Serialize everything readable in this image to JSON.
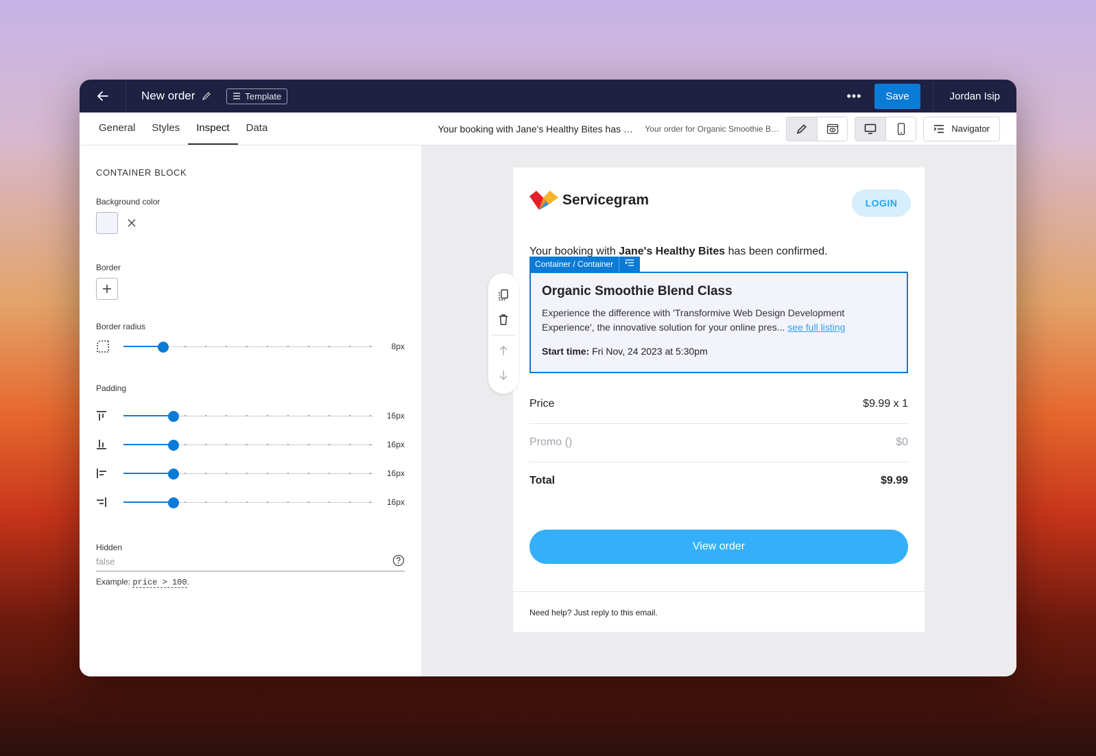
{
  "topbar": {
    "title": "New order",
    "template_label": "Template",
    "more_label": "•••",
    "save_label": "Save",
    "user_name": "Jordan Isip"
  },
  "tabs": [
    {
      "label": "General"
    },
    {
      "label": "Styles"
    },
    {
      "label": "Inspect",
      "active": true
    },
    {
      "label": "Data"
    }
  ],
  "subject": {
    "main": "Your booking with Jane's Healthy Bites has been confirmed",
    "preview": "Your order for Organic Smoothie Blend Class"
  },
  "navigator_label": "Navigator",
  "inspector": {
    "section_title": "CONTAINER BLOCK",
    "background_color": {
      "label": "Background color",
      "value": "#f2f3fb"
    },
    "border": {
      "label": "Border"
    },
    "border_radius": {
      "label": "Border radius",
      "value": "8px",
      "fraction": 0.16
    },
    "padding": {
      "label": "Padding",
      "top": {
        "value": "16px",
        "fraction": 0.2
      },
      "bottom": {
        "value": "16px",
        "fraction": 0.2
      },
      "left": {
        "value": "16px",
        "fraction": 0.2
      },
      "right": {
        "value": "16px",
        "fraction": 0.2
      }
    },
    "hidden": {
      "label": "Hidden",
      "placeholder": "false",
      "example_prefix": "Example: ",
      "example_code": "price > 100",
      "example_suffix": "."
    }
  },
  "email": {
    "brand": "Servicegram",
    "login_label": "LOGIN",
    "confirm_prefix": "Your booking with ",
    "confirm_business": "Jane's Healthy Bites",
    "confirm_suffix": " has been confirmed.",
    "selection_label": "Container / Container",
    "card": {
      "title": "Organic Smoothie Blend Class",
      "description": "Experience the difference with 'Transformive Web Design Development Experience', the innovative solution for your online pres...",
      "link": "see full listing",
      "start_label": "Start time:",
      "start_value": "Fri Nov, 24 2023 at 5:30pm"
    },
    "price": {
      "label": "Price",
      "value": "$9.99 x 1"
    },
    "promo": {
      "label": "Promo ()",
      "value": "$0"
    },
    "total": {
      "label": "Total",
      "value": "$9.99"
    },
    "view_order_label": "View order",
    "help": "Need help? Just reply to this email."
  },
  "colors": {
    "accent": "#0b7bd6",
    "topbar": "#1f2143",
    "cta": "#34b0fb"
  }
}
